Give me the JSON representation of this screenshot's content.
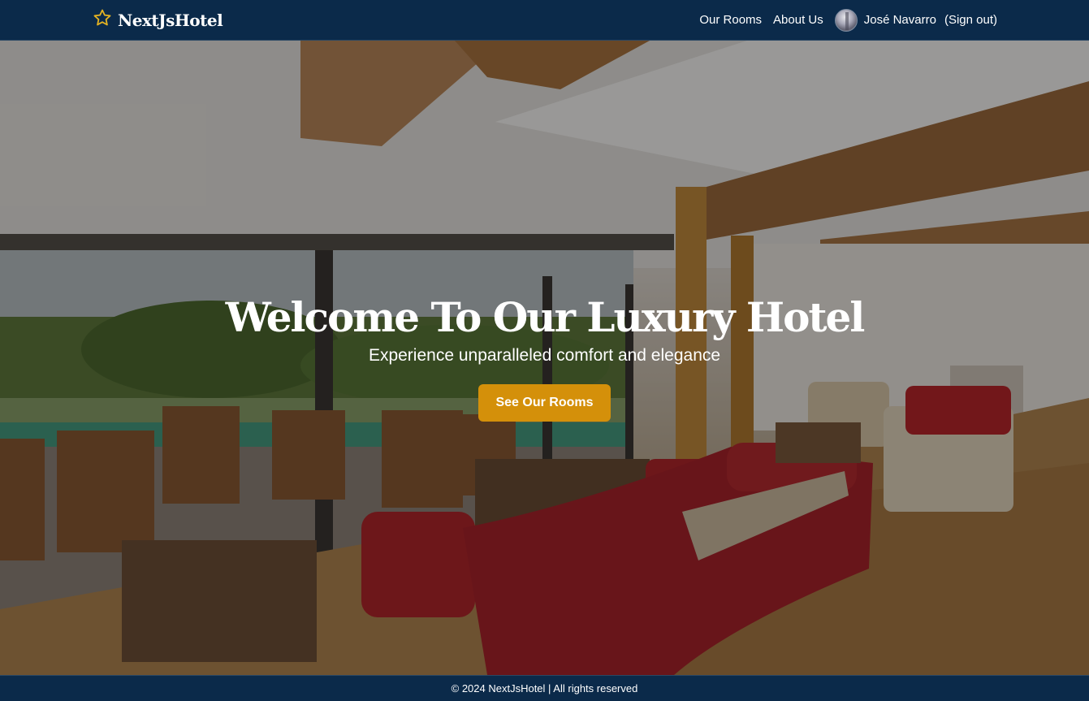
{
  "header": {
    "brand": "NextJsHotel",
    "brand_icon": "star-icon",
    "nav": [
      {
        "label": "Our Rooms"
      },
      {
        "label": "About Us"
      }
    ],
    "user": {
      "name": "José Navarro",
      "signout_label": "(Sign out)"
    }
  },
  "hero": {
    "title": "Welcome To Our Luxury Hotel",
    "subtitle": "Experience unparalleled comfort and elegance",
    "cta_label": "See Our Rooms"
  },
  "footer": {
    "text": "© 2024 NextJsHotel | All rights reserved"
  },
  "colors": {
    "navy": "#0b2a4a",
    "accent": "#d4900a",
    "star": "#e6b422"
  }
}
